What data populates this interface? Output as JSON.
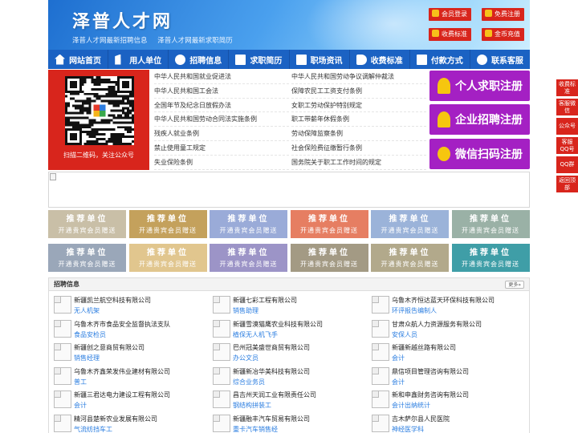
{
  "header": {
    "site_title": "泽普人才网",
    "subtitles": [
      "泽普人才网最新招聘信息",
      "泽普人才网最新求职简历"
    ],
    "buttons": {
      "member_login": "会员登录",
      "free_register": "免费注册",
      "pricing": "收费标准",
      "gold_recharge": "金币充值"
    }
  },
  "nav": {
    "items": [
      "网站首页",
      "用人单位",
      "招聘信息",
      "求职简历",
      "职场资讯",
      "收费标准",
      "付款方式",
      "联系客服"
    ]
  },
  "qr": {
    "caption": "扫描二维码，关注公众号"
  },
  "laws": {
    "left": [
      "中华人民共和国就业促进法",
      "中华人民共和国工会法",
      "全国年节及纪念日放假办法",
      "中华人民共和国劳动合同法实施条例",
      "残疾人就业条例",
      "禁止使用童工规定",
      "失业保险条例"
    ],
    "right": [
      "中华人民共和国劳动争议调解仲裁法",
      "保障农民工工资支付条例",
      "女职工劳动保护特别规定",
      "职工带薪年休假条例",
      "劳动保障监察条例",
      "社会保险费征缴暂行条例",
      "国务院关于职工工作时间的规定"
    ]
  },
  "register": {
    "personal": "个人求职注册",
    "company": "企业招聘注册",
    "wechat": "微信扫码注册"
  },
  "recommended": {
    "title": "推荐单位",
    "subtitle": "开通贵宾会员赠送",
    "colors": [
      "#c9bfa7",
      "#c4a15c",
      "#9aabd8",
      "#e67e62",
      "#9bb3d9",
      "#9ab1a6",
      "#9aa7b9",
      "#e1c68e",
      "#9c94c7",
      "#a39a84",
      "#b2a98b",
      "#3f9ea7"
    ]
  },
  "jobs": {
    "section_title": "招聘信息",
    "more_label": "更多»",
    "items": [
      {
        "company": "新疆凯兰航空科技有限公司",
        "position": "无人机架"
      },
      {
        "company": "新疆七彩工程有限公司",
        "position": "销售助理"
      },
      {
        "company": "乌鲁木齐恒达蓝天环保科技有限公司",
        "position": "环评报告编制人"
      },
      {
        "company": "乌鲁木齐市食品安全监督执法支队",
        "position": "食品安检员"
      },
      {
        "company": "新疆雪漠猫鹰农业科技有限公司",
        "position": "植保无人机飞手"
      },
      {
        "company": "甘肃众航人力资源服务有限公司",
        "position": "安保人员"
      },
      {
        "company": "新疆创之意商贸有限公司",
        "position": "销售经理"
      },
      {
        "company": "巴州冠美盛世商贸有限公司",
        "position": "办公文员"
      },
      {
        "company": "新疆新越丝路有限公司",
        "position": "会计"
      },
      {
        "company": "乌鲁木齐鑫荣发伟业建材有限公司",
        "position": "普工"
      },
      {
        "company": "新疆新冶华美科技有限公司",
        "position": "综合业务员"
      },
      {
        "company": "鼎信项目管理咨询有限公司",
        "position": "会计"
      },
      {
        "company": "新疆三君达电力建设工程有限公司",
        "position": "会计"
      },
      {
        "company": "昌吉州天润工业有限责任公司",
        "position": "钢结构拼装工"
      },
      {
        "company": "新和申鑫财务咨询有限公司",
        "position": "会计出纳统计"
      },
      {
        "company": "精河县楚新农业发展有限公司",
        "position": "气流纺挡车工"
      },
      {
        "company": "新疆融丰汽车贸易有限公司",
        "position": "重卡汽车销售经"
      },
      {
        "company": "吉木萨尔县人民医院",
        "position": "神经医学科"
      }
    ]
  },
  "float_bar": {
    "items": [
      "收费标准",
      "客服微信",
      "公众号",
      "客服QQ号",
      "QQ群",
      "返回顶部"
    ]
  }
}
